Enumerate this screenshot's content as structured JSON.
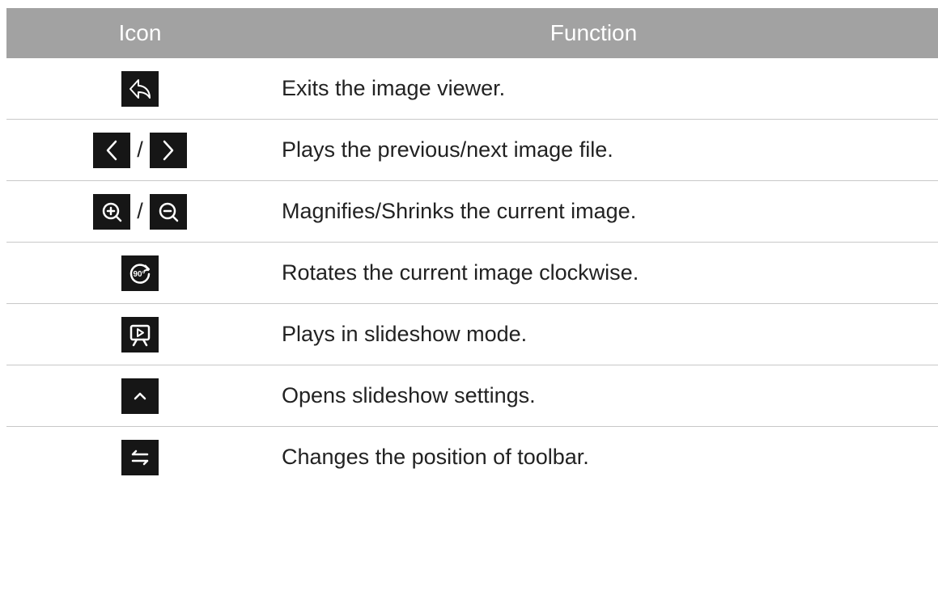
{
  "header": {
    "icon_col": "Icon",
    "function_col": "Function"
  },
  "separator": "/",
  "rows": [
    {
      "icons": [
        "exit-icon"
      ],
      "text": "Exits the image viewer."
    },
    {
      "icons": [
        "chevron-left-icon",
        "chevron-right-icon"
      ],
      "text": "Plays the previous/next image file."
    },
    {
      "icons": [
        "zoom-in-icon",
        "zoom-out-icon"
      ],
      "text": "Magnifies/Shrinks the current image."
    },
    {
      "icons": [
        "rotate-90-icon"
      ],
      "text": "Rotates the current image clockwise."
    },
    {
      "icons": [
        "slideshow-icon"
      ],
      "text": "Plays in slideshow mode."
    },
    {
      "icons": [
        "chevron-up-icon"
      ],
      "text": "Opens slideshow settings."
    },
    {
      "icons": [
        "swap-arrows-icon"
      ],
      "text": "Changes the position of toolbar."
    }
  ],
  "icon_labels": {
    "rotate": "90°"
  },
  "colors": {
    "header_bg": "#a2a2a2",
    "icon_bg": "#161616",
    "icon_fg": "#ffffff",
    "divider": "#c8c8c8"
  }
}
